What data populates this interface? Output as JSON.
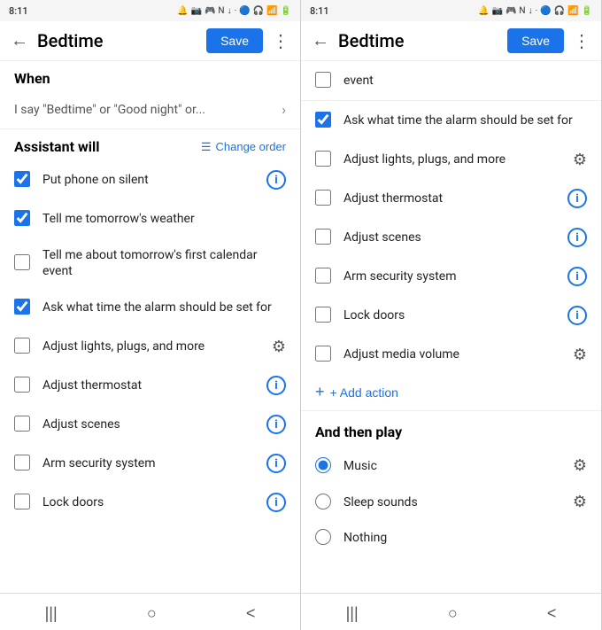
{
  "left_panel": {
    "status": {
      "time": "8:11",
      "icons": "🔔 🖼 🎮 📶 ↓ · 🔵 🎧 📶 📶 🔋"
    },
    "header": {
      "back_label": "←",
      "title": "Bedtime",
      "save_label": "Save",
      "more_label": "⋮"
    },
    "when_section": {
      "label": "When",
      "trigger_text": "I say \"Bedtime\" or \"Good night\" or..."
    },
    "assistant_will": {
      "label": "Assistant will",
      "change_order_label": "Change order"
    },
    "actions": [
      {
        "id": "put-phone-silent",
        "label": "Put phone on silent",
        "checked": true,
        "icon_type": "info"
      },
      {
        "id": "tell-weather",
        "label": "Tell me tomorrow's weather",
        "checked": true,
        "icon_type": "none"
      },
      {
        "id": "tell-calendar",
        "label": "Tell me about tomorrow's first calendar event",
        "checked": false,
        "icon_type": "none"
      },
      {
        "id": "ask-alarm",
        "label": "Ask what time the alarm should be set for",
        "checked": true,
        "icon_type": "none"
      },
      {
        "id": "adjust-lights",
        "label": "Adjust lights, plugs, and more",
        "checked": false,
        "icon_type": "gear"
      },
      {
        "id": "adjust-thermostat",
        "label": "Adjust thermostat",
        "checked": false,
        "icon_type": "info"
      },
      {
        "id": "adjust-scenes",
        "label": "Adjust scenes",
        "checked": false,
        "icon_type": "info"
      },
      {
        "id": "arm-security",
        "label": "Arm security system",
        "checked": false,
        "icon_type": "info"
      },
      {
        "id": "lock-doors",
        "label": "Lock doors",
        "checked": false,
        "icon_type": "info"
      }
    ],
    "nav": {
      "menu_label": "|||",
      "home_label": "○",
      "back_label": "<"
    }
  },
  "right_panel": {
    "status": {
      "time": "8:11",
      "icons": "🔔 🖼 🎮 📶 ↓ · 🔵 🎧 📶 📶 🔋"
    },
    "header": {
      "back_label": "←",
      "title": "Bedtime",
      "save_label": "Save",
      "more_label": "⋮"
    },
    "actions": [
      {
        "id": "event-r",
        "label": "event",
        "checked": false,
        "icon_type": "none"
      },
      {
        "id": "ask-alarm-r",
        "label": "Ask what time the alarm should be set for",
        "checked": true,
        "icon_type": "none"
      },
      {
        "id": "adjust-lights-r",
        "label": "Adjust lights, plugs, and more",
        "checked": false,
        "icon_type": "gear"
      },
      {
        "id": "adjust-thermostat-r",
        "label": "Adjust thermostat",
        "checked": false,
        "icon_type": "info"
      },
      {
        "id": "adjust-scenes-r",
        "label": "Adjust scenes",
        "checked": false,
        "icon_type": "info"
      },
      {
        "id": "arm-security-r",
        "label": "Arm security system",
        "checked": false,
        "icon_type": "info"
      },
      {
        "id": "lock-doors-r",
        "label": "Lock doors",
        "checked": false,
        "icon_type": "info"
      },
      {
        "id": "adjust-media-r",
        "label": "Adjust media volume",
        "checked": false,
        "icon_type": "gear"
      }
    ],
    "add_action_label": "+ Add action",
    "and_then_play": {
      "label": "And then play",
      "options": [
        {
          "id": "music",
          "label": "Music",
          "selected": true,
          "icon_type": "gear"
        },
        {
          "id": "sleep-sounds",
          "label": "Sleep sounds",
          "selected": false,
          "icon_type": "gear"
        },
        {
          "id": "nothing",
          "label": "Nothing",
          "selected": false,
          "icon_type": "none"
        }
      ]
    },
    "nav": {
      "menu_label": "|||",
      "home_label": "○",
      "back_label": "<"
    }
  }
}
